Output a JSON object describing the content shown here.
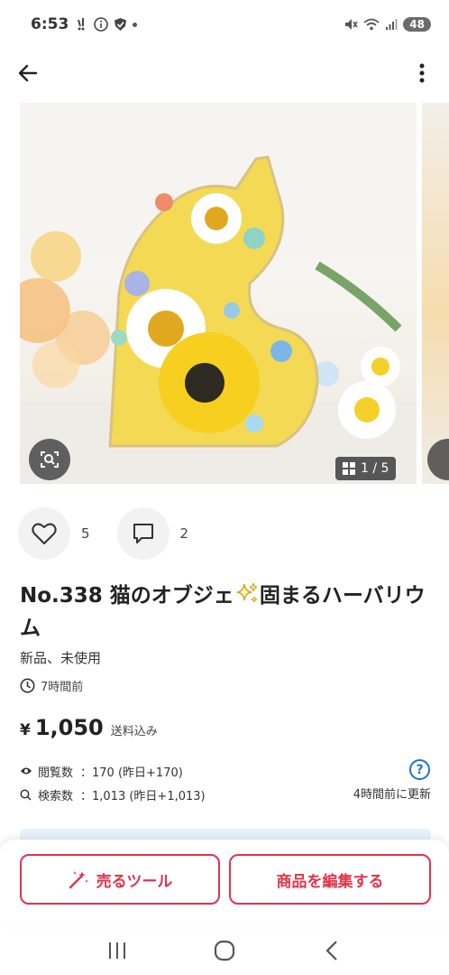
{
  "status_bar": {
    "time": "6:53",
    "battery": "48",
    "icons": [
      "notification-icon",
      "info-icon",
      "shield-icon",
      "mute-icon",
      "wifi-icon",
      "signal-icon"
    ]
  },
  "app_bar": {
    "back_icon": "arrow-left-icon",
    "menu_icon": "more-vertical-icon"
  },
  "gallery": {
    "page_indicator": "1 / 5",
    "lens_icon": "image-search-icon"
  },
  "actions": {
    "likes_count": "5",
    "comments_count": "2"
  },
  "product": {
    "title_part1": "No.338 猫のオブジェ",
    "title_part2": "固まるハーバリウム",
    "condition": "新品、未使用",
    "posted_time": "7時間前",
    "price_symbol": "¥",
    "price": "1,050",
    "price_note": "送料込み"
  },
  "stats": {
    "views_label": "閲覧数",
    "views_value": "：170 (昨日+170)",
    "searches_label": "検索数",
    "searches_value": "：1,013 (昨日+1,013)",
    "help_label": "?",
    "updated": "4時間前に更新"
  },
  "bottom_bar": {
    "sell_tool_label": "売るツール",
    "edit_label": "商品を編集する"
  },
  "colors": {
    "accent": "#e0344a",
    "help": "#1976d2",
    "info_strip": "#e6f3fc"
  }
}
